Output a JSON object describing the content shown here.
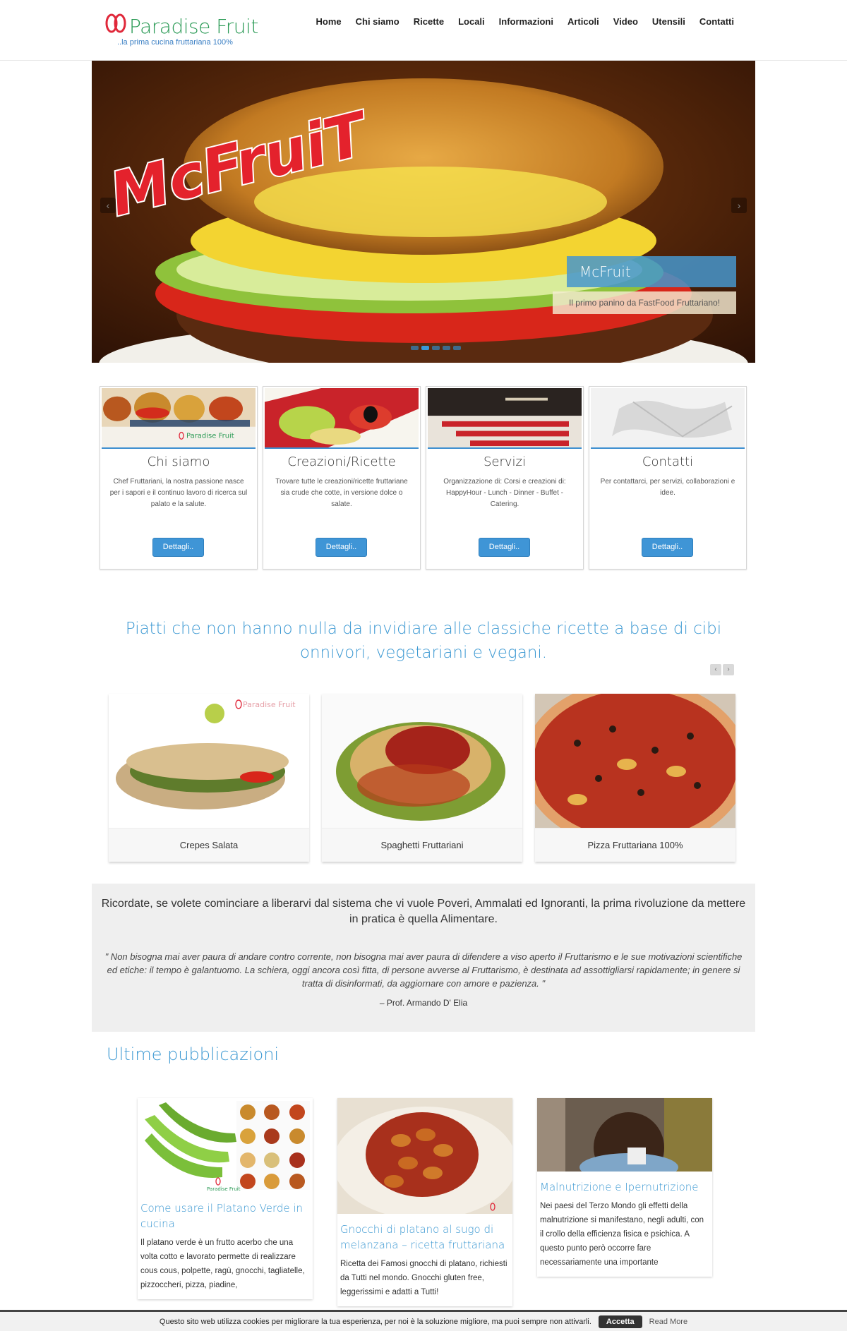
{
  "header": {
    "logo_text": "Paradise Fruit",
    "logo_tagline": "..la prima cucina fruttariana 100%",
    "nav": [
      "Home",
      "Chi siamo",
      "Ricette",
      "Locali",
      "Informazioni",
      "Articoli",
      "Video",
      "Utensili",
      "Contatti"
    ]
  },
  "hero": {
    "art_title": "McFruiT",
    "caption_title": "McFruit",
    "caption_subtitle": "Il primo panino da FastFood Fruttariano!",
    "slides_total": 5,
    "slide_active": 2
  },
  "cards": [
    {
      "title": "Chi siamo",
      "text": "Chef Fruttariani, la nostra passione nasce per i sapori e il continuo lavoro di ricerca sul palato e la salute.",
      "button": "Dettagli.."
    },
    {
      "title": "Creazioni/Ricette",
      "text": "Trovare tutte le creazioni/ricette fruttariane sia crude che cotte, in versione dolce o salate.",
      "button": "Dettagli.."
    },
    {
      "title": "Servizi",
      "text": "Organizzazione di: Corsi e creazioni di: HappyHour - Lunch - Dinner - Buffet - Catering.",
      "button": "Dettagli.."
    },
    {
      "title": "Contatti",
      "text": "Per contattarci, per servizi, collaborazioni e idee.",
      "button": "Dettagli.."
    }
  ],
  "tagline": "Piatti che non hanno nulla da invidiare alle classiche ricette a base di cibi onnivori, vegetariani e vegani.",
  "recipes": [
    {
      "name": "Crepes Salata",
      "watermark": "Paradise Fruit"
    },
    {
      "name": "Spaghetti Fruttariani"
    },
    {
      "name": "Pizza Fruttariana 100%"
    }
  ],
  "quote": {
    "lead": "Ricordate, se volete cominciare a liberarvi dal sistema che vi vuole Poveri, Ammalati ed Ignoranti, la prima rivoluzione da mettere in pratica è quella Alimentare.",
    "body": "\" Non bisogna mai aver paura di andare contro corrente, non bisogna mai aver paura di difendere a viso aperto il Fruttarismo e le sue motivazioni scientifiche ed etiche: il tempo è galantuomo. La schiera, oggi ancora così fitta, di persone avverse al Fruttarismo, è destinata ad assottigliarsi rapidamente; in genere si tratta di disinformati, da aggiornare con amore e pazienza. \"",
    "author": "– Prof. Armando D' Elia"
  },
  "posts_section": {
    "title": "Ultime pubblicazioni",
    "posts": [
      {
        "title": "Come usare il Platano Verde in cucina",
        "excerpt": "Il platano verde è un frutto acerbo che una volta cotto e lavorato permette di realizzare cous cous, polpette, ragù, gnocchi, tagliatelle, pizzoccheri, pizza, piadine,",
        "image_label": "Paradise Fruit"
      },
      {
        "title": "Gnocchi di platano al sugo di melanzana – ricetta fruttariana",
        "excerpt": "Ricetta dei Famosi gnocchi di platano, richiesti da Tutti nel mondo. Gnocchi gluten free, leggerissimi e adatti a Tutti!"
      },
      {
        "title": "Malnutrizione e Ipernutrizione",
        "excerpt": "Nei paesi del Terzo Mondo gli effetti della malnutrizione si manifestano, negli adulti, con il crollo della efficienza fisica e psichica. A questo punto però occorre fare necessariamente una importante"
      }
    ]
  },
  "cookie": {
    "text": "Questo sito web utilizza cookies per migliorare la tua esperienza, per noi è la soluzione migliore, ma puoi sempre non attivarli.",
    "accept": "Accetta",
    "more": "Read More"
  },
  "colors": {
    "accent": "#3b98d2",
    "logo_green": "#2a9a55",
    "logo_red": "#e0283a",
    "button": "#3f95d6"
  }
}
